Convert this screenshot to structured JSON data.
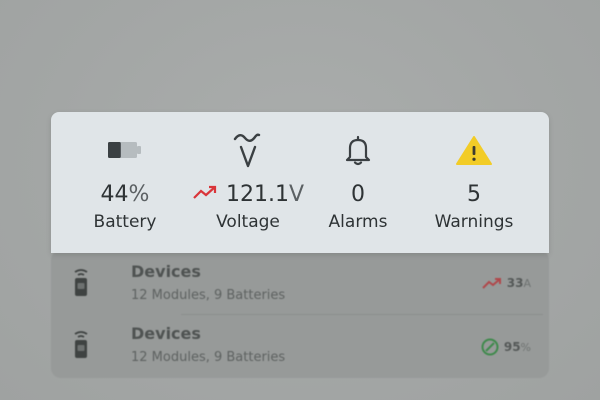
{
  "stats": {
    "battery": {
      "value": "44",
      "unit": "%",
      "label": "Battery",
      "icon": "battery-icon",
      "level": 0.44
    },
    "voltage": {
      "value": "121.1",
      "unit": "V",
      "label": "Voltage",
      "icon": "voltage-icon",
      "trend_icon": "trend-up-icon"
    },
    "alarms": {
      "value": "0",
      "label": "Alarms",
      "icon": "bell-icon"
    },
    "warnings": {
      "value": "5",
      "label": "Warnings",
      "icon": "warning-icon"
    }
  },
  "devices": [
    {
      "title": "Devices",
      "subtitle": "12 Modules, 9 Batteries",
      "metric_value": "33",
      "metric_unit": "A",
      "metric_icon": "trend-up-icon"
    },
    {
      "title": "Devices",
      "subtitle": "12 Modules, 9 Batteries",
      "metric_value": "95",
      "metric_unit": "%",
      "metric_icon": "check-circle-icon"
    }
  ],
  "colors": {
    "trend_red": "#d9353a",
    "warning_yellow": "#f2cc27",
    "check_green": "#3e9a52",
    "card_bg": "#e0e5e8",
    "text_dark": "#2e3335"
  }
}
